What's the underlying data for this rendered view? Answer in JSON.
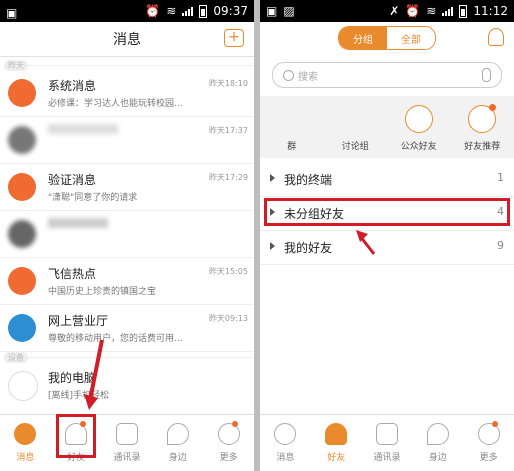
{
  "left": {
    "status": {
      "time": "09:37"
    },
    "header": {
      "title": "消息"
    },
    "section_top": "昨天",
    "section_bottom": "设备",
    "messages": [
      {
        "title": "系统消息",
        "time": "昨天18:10",
        "preview": "必修课：学习达人也能玩转校园..."
      },
      {
        "title": "",
        "time": "昨天17:37",
        "preview": ""
      },
      {
        "title": "验证消息",
        "time": "昨天17:29",
        "preview": "\"潇聪\"同意了你的请求"
      },
      {
        "title": "",
        "time": "",
        "preview": ""
      },
      {
        "title": "飞信热点",
        "time": "昨天15:05",
        "preview": "中国历史上珍贵的镇国之宝"
      },
      {
        "title": "网上营业厅",
        "time": "昨天09:13",
        "preview": "尊敬的移动用户，您的话费可用..."
      },
      {
        "title": "我的电脑",
        "time": "",
        "preview": "[离线]手机轻松"
      }
    ],
    "tabs": [
      "消息",
      "好友",
      "通讯录",
      "身边",
      "更多"
    ]
  },
  "right": {
    "status": {
      "time": "11:12"
    },
    "segment": {
      "on": "分组",
      "off": "全部"
    },
    "search_placeholder": "搜索",
    "quick": [
      "群",
      "讨论组",
      "公众好友",
      "好友推荐"
    ],
    "groups": [
      {
        "name": "我的终端",
        "count": "1"
      },
      {
        "name": "未分组好友",
        "count": "4"
      },
      {
        "name": "我的好友",
        "count": "9"
      }
    ],
    "tabs": [
      "消息",
      "好友",
      "通讯录",
      "身边",
      "更多"
    ]
  },
  "colors": {
    "accent": "#e98a2c",
    "highlight": "#d11d26"
  }
}
